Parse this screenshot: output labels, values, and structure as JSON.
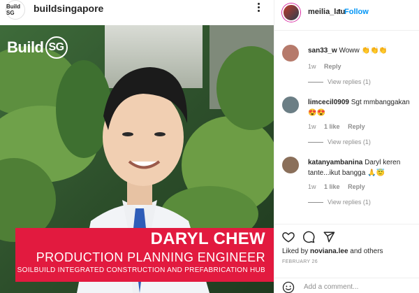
{
  "post": {
    "account_name": "buildsingapore",
    "avatar_text": "Build SG"
  },
  "photo": {
    "brand_text": "Build",
    "brand_circle": "SG",
    "banner_name": "DARYL CHEW",
    "banner_role": "PRODUCTION PLANNING ENGINEER",
    "banner_org": "SOILBUILD INTEGRATED CONSTRUCTION AND PREFABRICATION HUB",
    "banner_color": "#e21a3f"
  },
  "panel": {
    "username": "meilia_lau",
    "separator": "•",
    "follow_label": "Follow",
    "accent_color": "#0095f6"
  },
  "comments": [
    {
      "user": "san33_w",
      "text": "Woww 👏👏👏",
      "time": "1w",
      "likes": "",
      "reply": "Reply",
      "view_replies": "View replies (1)"
    },
    {
      "user": "limcecil0909",
      "text": "Sgt mmbanggakan 😍😍",
      "time": "1w",
      "likes": "1 like",
      "reply": "Reply",
      "view_replies": "View replies (1)"
    },
    {
      "user": "katanyambanina",
      "text": "Daryl keren tante...ikut bangga 🙏😇",
      "time": "1w",
      "likes": "1 like",
      "reply": "Reply",
      "view_replies": "View replies (1)"
    }
  ],
  "actions": {
    "liked_by_prefix": "Liked by",
    "liked_by_user": "noviana.lee",
    "liked_by_suffix": "and others",
    "date": "FEBRUARY 26",
    "comment_placeholder": "Add a comment..."
  },
  "icons": {
    "more": "more-options-icon",
    "like": "heart-icon",
    "comment": "comment-icon",
    "share": "share-icon",
    "emoji": "emoji-icon"
  }
}
